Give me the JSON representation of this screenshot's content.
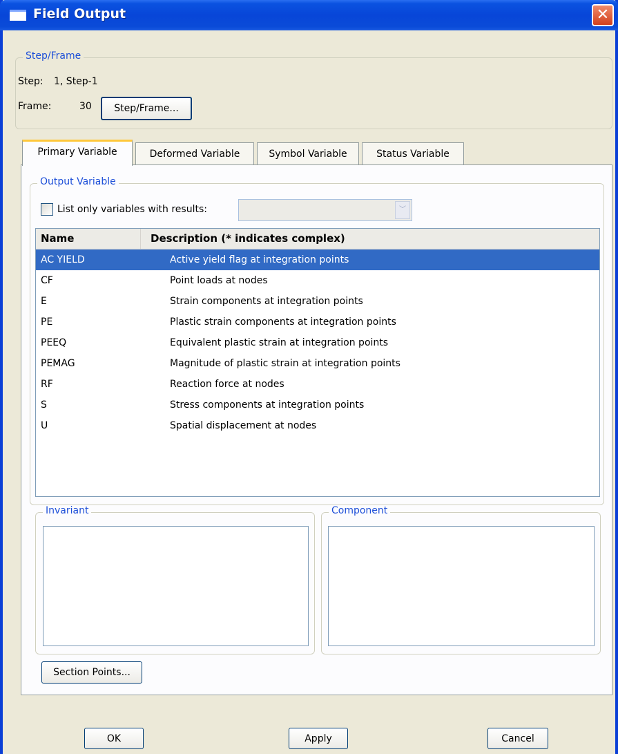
{
  "window": {
    "title": "Field Output",
    "close_glyph": "✕"
  },
  "step_frame": {
    "legend": "Step/Frame",
    "step_label": "Step:",
    "step_value": "1, Step-1",
    "frame_label": "Frame:",
    "frame_value": "30",
    "button_label": "Step/Frame..."
  },
  "tabs": [
    {
      "label": "Primary Variable",
      "active": true
    },
    {
      "label": "Deformed Variable",
      "active": false
    },
    {
      "label": "Symbol Variable",
      "active": false
    },
    {
      "label": "Status Variable",
      "active": false
    }
  ],
  "output_variable": {
    "legend": "Output Variable",
    "checkbox_label": "List only variables with results:",
    "checkbox_checked": false,
    "combo_value": "",
    "columns": [
      "Name",
      "Description (* indicates complex)"
    ],
    "rows": [
      {
        "name": "AC YIELD",
        "description": "Active yield flag at integration points",
        "selected": true
      },
      {
        "name": "CF",
        "description": "Point loads at nodes",
        "selected": false
      },
      {
        "name": "E",
        "description": "Strain components at integration points",
        "selected": false
      },
      {
        "name": "PE",
        "description": "Plastic strain components at integration points",
        "selected": false
      },
      {
        "name": "PEEQ",
        "description": "Equivalent plastic strain at integration points",
        "selected": false
      },
      {
        "name": "PEMAG",
        "description": "Magnitude of plastic strain at integration points",
        "selected": false
      },
      {
        "name": "RF",
        "description": "Reaction force at nodes",
        "selected": false
      },
      {
        "name": "S",
        "description": "Stress components at integration points",
        "selected": false
      },
      {
        "name": "U",
        "description": "Spatial displacement at nodes",
        "selected": false
      }
    ]
  },
  "invariant": {
    "legend": "Invariant"
  },
  "component": {
    "legend": "Component"
  },
  "section_points_button": "Section Points...",
  "footer": {
    "ok": "OK",
    "apply": "Apply",
    "cancel": "Cancel"
  },
  "colors": {
    "title_bar": "#0846d8",
    "selection": "#316ac5",
    "legend_text": "#1c4ed8",
    "dialog_bg": "#ece9d8"
  }
}
